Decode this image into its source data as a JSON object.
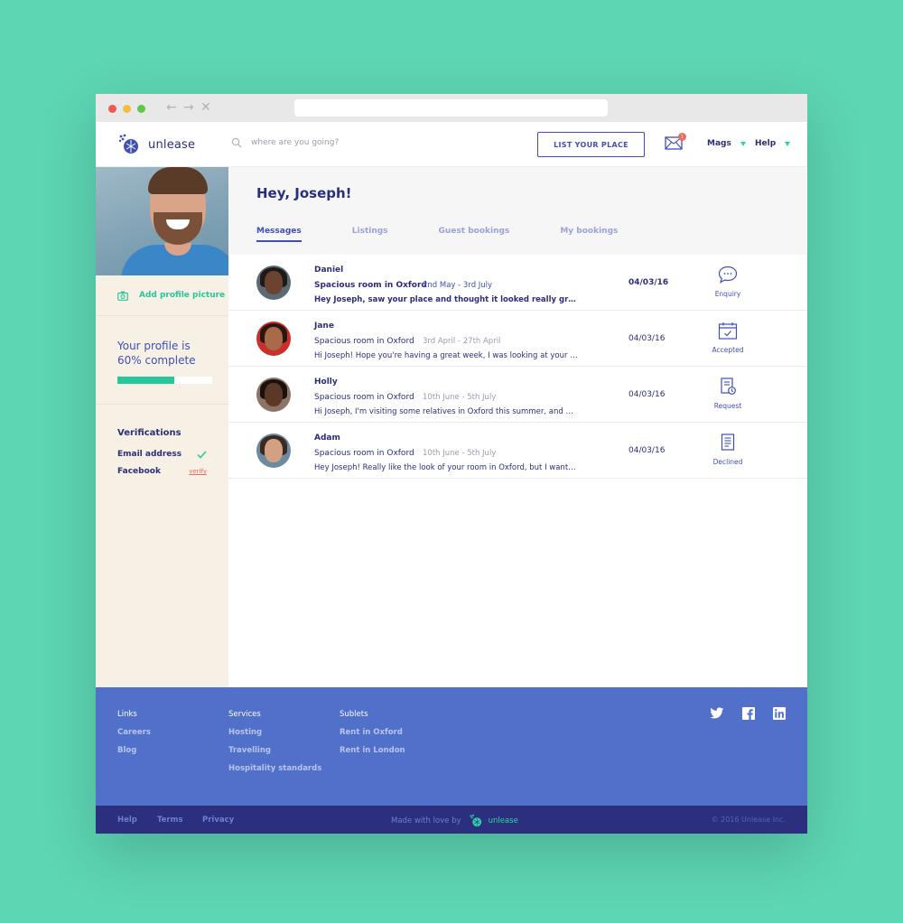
{
  "header": {
    "brand": "unlease",
    "search_placeholder": "where are you going?",
    "list_button": "LIST YOUR PLACE",
    "mail_badge": "1",
    "user_menu": "Mags",
    "help_menu": "Help"
  },
  "sidebar": {
    "add_picture": "Add profile picture",
    "profile_line1": "Your profile is",
    "profile_line2": "60% complete",
    "profile_percent": 60,
    "verifications_title": "Verifications",
    "email": "Email address",
    "facebook": "Facebook",
    "verify": "verify"
  },
  "main": {
    "greeting": "Hey, Joseph!",
    "tabs": [
      "Messages",
      "Listings",
      "Guest bookings",
      "My bookings"
    ]
  },
  "messages": [
    {
      "name": "Daniel",
      "listing": "Spacious room in Oxford",
      "dates": "2nd May - 3rd July",
      "preview": "Hey Joseph, saw your place and thought it looked really great. I just wa...",
      "date": "04/03/16",
      "status": "Enquiry"
    },
    {
      "name": "Jane",
      "listing": "Spacious room in Oxford",
      "dates": "3rd April - 27th April",
      "preview": "Hi Joseph! Hope you're having a great week, I was looking at your room...",
      "date": "04/03/16",
      "status": "Accepted"
    },
    {
      "name": "Holly",
      "listing": "Spacious room in Oxford",
      "dates": "10th June - 5th July",
      "preview": "Hi Joseph, I'm visiting some relatives in Oxford this summer, and would l...",
      "date": "04/03/16",
      "status": "Request"
    },
    {
      "name": "Adam",
      "listing": "Spacious room in Oxford",
      "dates": "10th June - 5th July",
      "preview": "Hey Joseph! Really like the look of your room in Oxford, but I wanted to...",
      "date": "04/03/16",
      "status": "Declined"
    }
  ],
  "footer": {
    "col1_title": "Links",
    "col1": [
      "Careers",
      "Blog"
    ],
    "col2_title": "Services",
    "col2": [
      "Hosting",
      "Travelling",
      "Hospitality standards"
    ],
    "col3_title": "Sublets",
    "col3": [
      "Rent in Oxford",
      "Rent in London"
    ],
    "bottom_links": [
      "Help",
      "Terms",
      "Privacy"
    ],
    "made_with": "Made with love by",
    "made_brand": "unlease",
    "copyright": "© 2016 Unlease Inc."
  },
  "colors": {
    "background": "#5dd6b4",
    "primary": "#3f4fb5",
    "accent": "#27c79b",
    "footer": "#5170c9",
    "footer_bottom": "#2b2f7e",
    "alert": "#f06a5e"
  }
}
